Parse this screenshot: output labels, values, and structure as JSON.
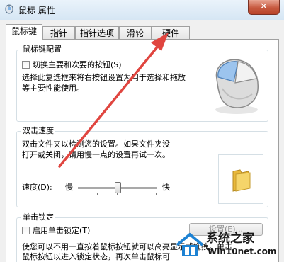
{
  "window": {
    "title": "鼠标 属性",
    "close_label": "✕"
  },
  "tabs": [
    {
      "label": "鼠标键",
      "active": true
    },
    {
      "label": "指针",
      "active": false
    },
    {
      "label": "指针选项",
      "active": false
    },
    {
      "label": "滑轮",
      "active": false
    },
    {
      "label": "硬件",
      "active": false
    }
  ],
  "button_config": {
    "group_title": "鼠标键配置",
    "swap_checkbox_label": "切换主要和次要的按钮(S)",
    "swap_checked": false,
    "description_line1": "选择此复选框来将右按钮设置为用于选择和拖放",
    "description_line2": "等主要性能使用。"
  },
  "double_click": {
    "group_title": "双击速度",
    "description_line1": "双击文件夹以检测您的设置。如果文件夹没",
    "description_line2": "打开或关闭，请用慢一点的设置再试一次。",
    "speed_label": "速度(D):",
    "slow_label": "慢",
    "fast_label": "快",
    "speed_level": 0.5
  },
  "click_lock": {
    "group_title": "单击锁定",
    "checkbox_label": "启用单击锁定(T)",
    "checked": false,
    "settings_button": "设置(E)...",
    "description_line1": "使您可以不用一直按着鼠标按钮就可以高亮显示或拖拽。单击",
    "description_line2": "鼠标按钮以进入锁定状态，再次单击鼠标可"
  },
  "watermark": {
    "site_name": "系统之家",
    "site_url": "Win10net.com"
  },
  "colors": {
    "annotation_arrow": "#e0453f",
    "close_button": "#c75a40",
    "folder": "#f0c84a"
  }
}
